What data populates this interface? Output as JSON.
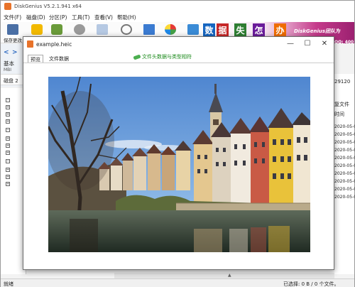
{
  "main_window": {
    "title": "DiskGenius V5.2.1.941 x64",
    "menu": [
      "文件(F)",
      "磁盘(D)",
      "分区(P)",
      "工具(T)",
      "查看(V)",
      "帮助(H)"
    ],
    "toolbar": {
      "save_label": "保存更改"
    },
    "banner_text": "DiskGenius团队为",
    "banner_tiles": [
      "数",
      "据",
      "失",
      "怎",
      "办"
    ],
    "side": {
      "nav_back": "<",
      "nav_fwd": ">",
      "basic_label": "基本",
      "mbr_label": "MBI"
    },
    "disk_label": "磁盘 2",
    "right_panel": {
      "number": "QQ: 400",
      "size": "29120",
      "labels": [
        "复文件",
        "时间"
      ],
      "dates": [
        "2020-05-0",
        "2020-05-0",
        "2020-05-0",
        "2020-05-0",
        "2020-05-0",
        "2020-05-0",
        "2020-05-0",
        "2020-05-0",
        "2020-05-0",
        "2020-05-0"
      ]
    },
    "status": {
      "left": "就绪",
      "right": "已选择: 0 B / 0 个文件。"
    }
  },
  "preview_dialog": {
    "title": "example.heic",
    "tabs": [
      "预览",
      "文件数据"
    ],
    "active_tab": "预览",
    "detect_link": "文件头数据与类型相符",
    "controls": {
      "minimize": "—",
      "maximize": "☐",
      "close": "✕"
    }
  },
  "colors": {
    "sky": "#6f9fd8",
    "accent_orange": "#e8732a",
    "link_green": "#1b8a1b"
  }
}
